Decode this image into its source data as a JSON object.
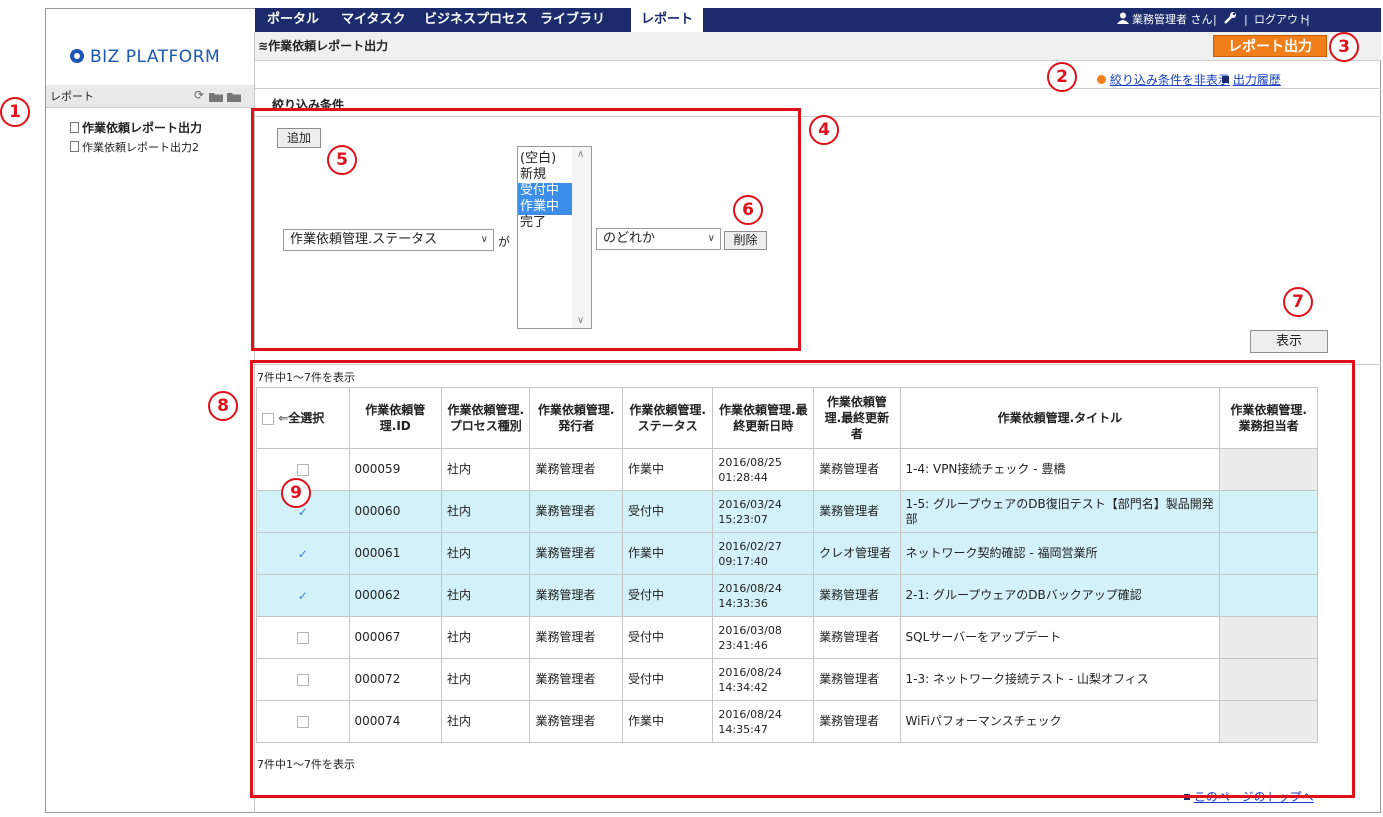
{
  "nav": {
    "tabs": [
      "ポータル",
      "マイタスク",
      "ビジネスプロセス",
      "ライブラリ",
      "レポート"
    ],
    "user": "業務管理者 さん",
    "logout": "ログアウト",
    "separator": "|"
  },
  "logo": {
    "text": "BIZ PLATFORM"
  },
  "sidebar": {
    "title": "レポート",
    "items": [
      {
        "label": "作業依頼レポート出力"
      },
      {
        "label": "作業依頼レポート出力2"
      }
    ]
  },
  "page": {
    "title": "作業依頼レポート出力",
    "report_button": "レポート出力",
    "hide_filter_link": "絞り込み条件を非表示",
    "history_link": "出力履歴"
  },
  "filter": {
    "title": "絞り込み条件",
    "add_button": "追加",
    "field_select": "作業依頼管理.ステータス",
    "ga": "が",
    "options": [
      {
        "label": "(空白)",
        "selected": false
      },
      {
        "label": "新規",
        "selected": false
      },
      {
        "label": "受付中",
        "selected": true
      },
      {
        "label": "作業中",
        "selected": true
      },
      {
        "label": "完了",
        "selected": false
      }
    ],
    "operator_select": "のどれか",
    "delete_button": "削除",
    "show_button": "表示"
  },
  "table": {
    "count_label": "7件中1～7件を表示",
    "headers": {
      "select_all": "全選択",
      "id": "作業依頼管理.ID",
      "process": "作業依頼管理.プロセス種別",
      "issuer": "作業依頼管理.発行者",
      "status": "作業依頼管理.ステータス",
      "updated": "作業依頼管理.最終更新日時",
      "updater": "作業依頼管理.最終更新者",
      "title": "作業依頼管理.タイトル",
      "assignee": "作業依頼管理.業務担当者"
    },
    "rows": [
      {
        "checked": false,
        "id": "000059",
        "process": "社内",
        "issuer": "業務管理者",
        "status": "作業中",
        "date": "2016/08/25",
        "time": "01:28:44",
        "updater": "業務管理者",
        "title": "1-4: VPN接続チェック - 豊橋"
      },
      {
        "checked": true,
        "id": "000060",
        "process": "社内",
        "issuer": "業務管理者",
        "status": "受付中",
        "date": "2016/03/24",
        "time": "15:23:07",
        "updater": "業務管理者",
        "title": "1-5: グループウェアのDB復旧テスト【部門名】製品開発部"
      },
      {
        "checked": true,
        "id": "000061",
        "process": "社内",
        "issuer": "業務管理者",
        "status": "作業中",
        "date": "2016/02/27",
        "time": "09:17:40",
        "updater": "クレオ管理者",
        "title": "ネットワーク契約確認 - 福岡営業所"
      },
      {
        "checked": true,
        "id": "000062",
        "process": "社内",
        "issuer": "業務管理者",
        "status": "受付中",
        "date": "2016/08/24",
        "time": "14:33:36",
        "updater": "業務管理者",
        "title": "2-1: グループウェアのDBバックアップ確認"
      },
      {
        "checked": false,
        "id": "000067",
        "process": "社内",
        "issuer": "業務管理者",
        "status": "受付中",
        "date": "2016/03/08",
        "time": "23:41:46",
        "updater": "業務管理者",
        "title": "SQLサーバーをアップデート"
      },
      {
        "checked": false,
        "id": "000072",
        "process": "社内",
        "issuer": "業務管理者",
        "status": "受付中",
        "date": "2016/08/24",
        "time": "14:34:42",
        "updater": "業務管理者",
        "title": "1-3: ネットワーク接続テスト - 山梨オフィス"
      },
      {
        "checked": false,
        "id": "000074",
        "process": "社内",
        "issuer": "業務管理者",
        "status": "作業中",
        "date": "2016/08/24",
        "time": "14:35:47",
        "updater": "業務管理者",
        "title": "WiFiパフォーマンスチェック"
      }
    ]
  },
  "footer": {
    "top_link": "このページのトップへ"
  },
  "annotations": [
    "1",
    "2",
    "3",
    "4",
    "5",
    "6",
    "7",
    "8",
    "9"
  ],
  "colors": {
    "nav": "#1b2b6b",
    "accent": "#f07f1a",
    "highlight": "#d2f1f8",
    "marker": "#e0101a"
  }
}
